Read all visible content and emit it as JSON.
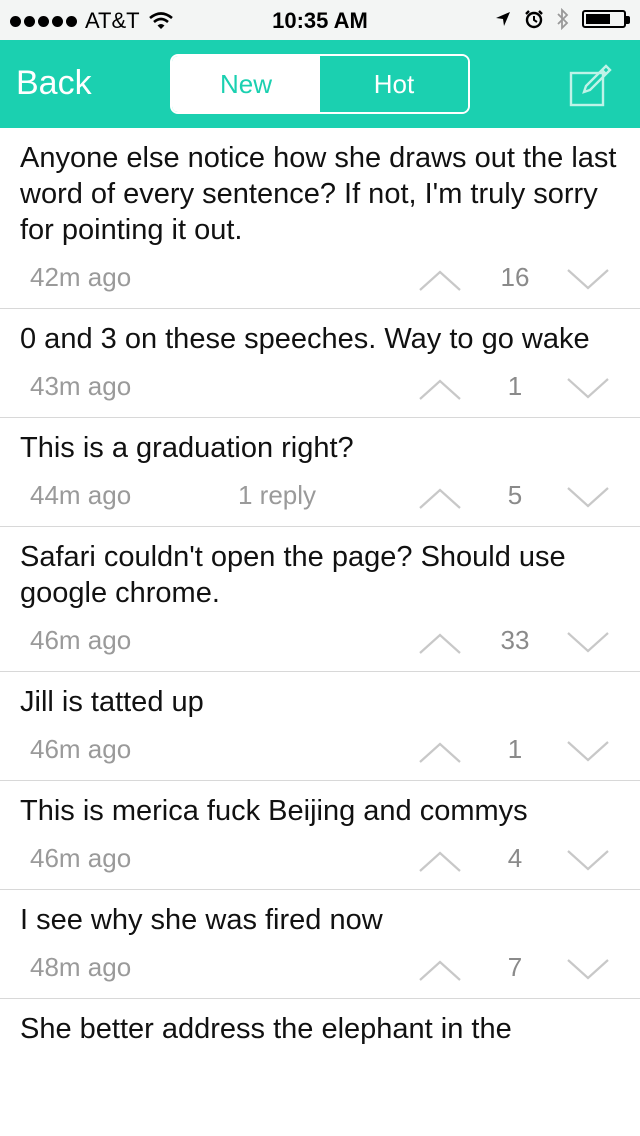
{
  "status": {
    "carrier": "AT&T",
    "time": "10:35 AM"
  },
  "nav": {
    "back": "Back",
    "tabs": [
      "New",
      "Hot"
    ]
  },
  "posts": [
    {
      "text": "Anyone else notice how she draws out the last word of every sentence? If not, I'm truly sorry for pointing it out.",
      "time": "42m ago",
      "replies": "",
      "votes": "16"
    },
    {
      "text": "0 and 3 on these speeches. Way to go wake",
      "time": "43m ago",
      "replies": "",
      "votes": "1"
    },
    {
      "text": "This is a graduation right?",
      "time": "44m ago",
      "replies": "1 reply",
      "votes": "5"
    },
    {
      "text": "Safari couldn't open the page?  Should use google chrome.",
      "time": "46m ago",
      "replies": "",
      "votes": "33"
    },
    {
      "text": "Jill is tatted up",
      "time": "46m ago",
      "replies": "",
      "votes": "1"
    },
    {
      "text": "This is merica fuck Beijing and commys",
      "time": "46m ago",
      "replies": "",
      "votes": "4"
    },
    {
      "text": "I see why she was fired now",
      "time": "48m ago",
      "replies": "",
      "votes": "7"
    },
    {
      "text": "She better address the elephant in the",
      "time": "",
      "replies": "",
      "votes": ""
    }
  ],
  "colors": {
    "accent": "#1bd0b0",
    "statusbar_bg": "#f3f5f4",
    "meta_text": "#9a9a9a"
  },
  "icons": [
    "signal-dots-icon",
    "wifi-icon",
    "location-arrow-icon",
    "alarm-icon",
    "bluetooth-icon",
    "battery-icon",
    "compose-icon",
    "upvote-chevron-icon",
    "downvote-chevron-icon"
  ]
}
